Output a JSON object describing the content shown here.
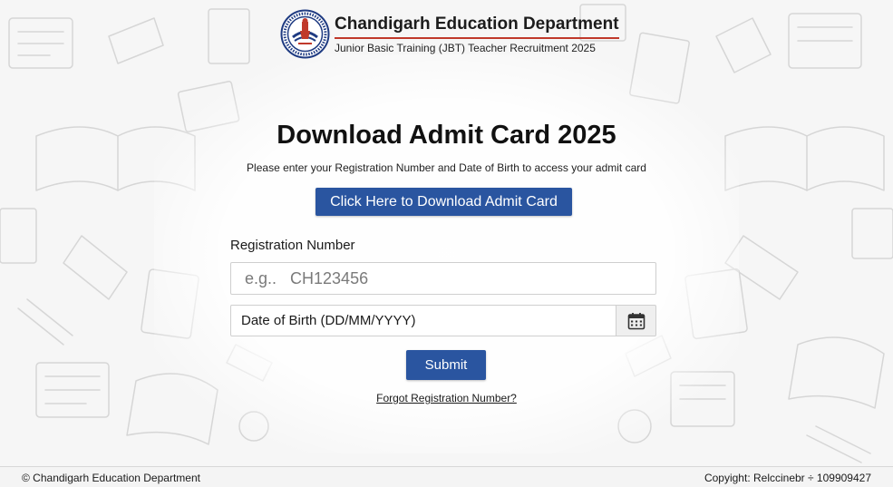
{
  "header": {
    "department": "Chandigarh Education Department",
    "subtitle": "Junior Basic Training (JBT) Teacher Recruitment 2025"
  },
  "main": {
    "title": "Download Admit Card 2025",
    "instruction": "Please enter your Registration Number and Date of Birth to access your admit card",
    "download_button": "Click Here to Download Admit Card",
    "registration_label": "Registration Number",
    "registration_placeholder": "e.g..   CH123456",
    "dob_placeholder": "Date of Birth (DD/MM/YYYY)",
    "submit_button": "Submit",
    "forgot_link": "Forgot Registration Number?"
  },
  "footer": {
    "left": "© Chandigarh Education Department",
    "right": "Copyight: Relccinebr ÷ 109909427"
  },
  "colors": {
    "primary_button": "#2a55a0",
    "header_accent": "#c0392b"
  },
  "icons": {
    "logo": "department-emblem",
    "calendar": "calendar-icon"
  }
}
